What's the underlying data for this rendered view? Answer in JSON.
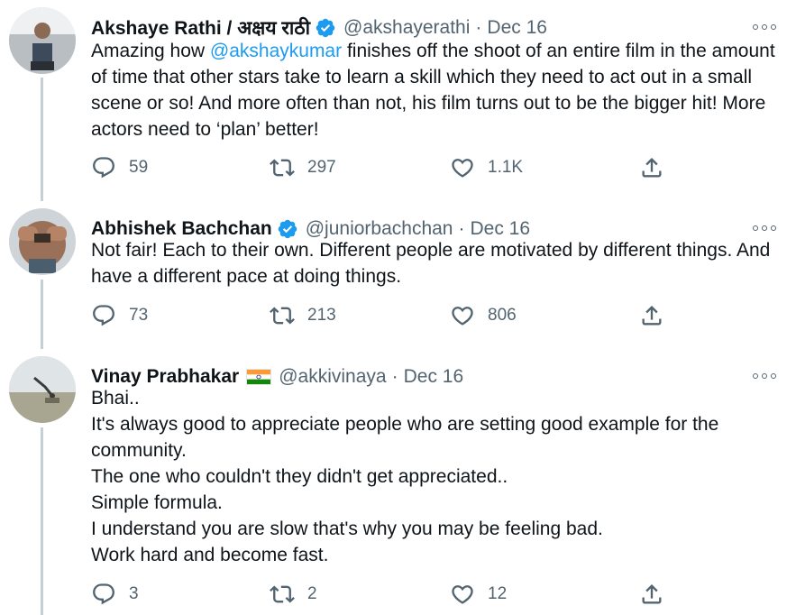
{
  "tweets": [
    {
      "name": "Akshaye Rathi / अक्षय राठी",
      "verified": true,
      "handle": "@akshayerathi",
      "separator": "·",
      "date": "Dec 16",
      "text_before": "Amazing how ",
      "mention": "@akshaykumar",
      "text_after": " finishes off the shoot of an entire film in the amount of time that other stars take to learn a skill which they need to act out in a small scene or so! And more often than not, his film turns out to be the bigger hit! More actors need to ‘plan’ better!",
      "replies": "59",
      "retweets": "297",
      "likes": "1.1K"
    },
    {
      "name": "Abhishek Bachchan",
      "verified": true,
      "handle": "@juniorbachchan",
      "separator": "·",
      "date": "Dec 16",
      "text": "Not fair! Each to their own. Different people are motivated by different things. And have a different pace at doing things.",
      "replies": "73",
      "retweets": "213",
      "likes": "806"
    },
    {
      "name": "Vinay Prabhakar",
      "flag": "india-flag",
      "handle": "@akkivinaya",
      "separator": "·",
      "date": "Dec 16",
      "lines": [
        "Bhai..",
        "It's always good to appreciate people who are setting good example for the community.",
        "The one who couldn't they didn't get appreciated..",
        "Simple formula.",
        "I understand you are slow that's why you may be feeling bad.",
        "Work hard and become fast."
      ],
      "replies": "3",
      "retweets": "2",
      "likes": "12"
    }
  ],
  "icons": {
    "reply": "reply-icon",
    "retweet": "retweet-icon",
    "like": "heart-icon",
    "share": "share-icon",
    "more": "more-icon",
    "verified": "verified-badge-icon"
  },
  "colors": {
    "accent": "#1d9bf0",
    "secondary_text": "#536471",
    "thread_line": "#c4cfd6"
  }
}
